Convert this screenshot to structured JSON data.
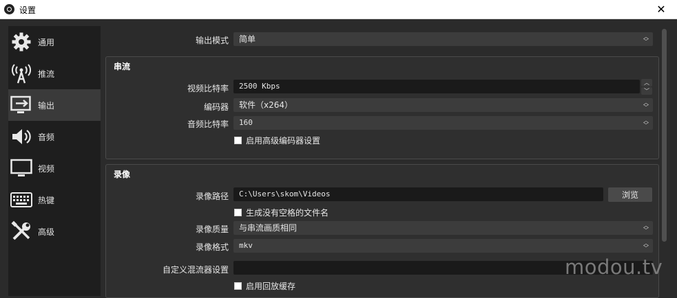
{
  "window": {
    "title": "设置",
    "close_glyph": "✕"
  },
  "sidebar": {
    "items": [
      {
        "label": "通用",
        "icon": "gear-icon"
      },
      {
        "label": "推流",
        "icon": "broadcast-icon"
      },
      {
        "label": "输出",
        "icon": "output-monitor-icon",
        "active": true
      },
      {
        "label": "音频",
        "icon": "speaker-icon"
      },
      {
        "label": "视频",
        "icon": "monitor-icon"
      },
      {
        "label": "热键",
        "icon": "keyboard-icon"
      },
      {
        "label": "高级",
        "icon": "tools-icon"
      }
    ]
  },
  "output_mode": {
    "label": "输出模式",
    "value": "简单"
  },
  "streaming": {
    "title": "串流",
    "video_bitrate_label": "视频比特率",
    "video_bitrate_value": "2500 Kbps",
    "encoder_label": "编码器",
    "encoder_value": "软件（x264）",
    "audio_bitrate_label": "音频比特率",
    "audio_bitrate_value": "160",
    "advanced_checkbox_label": "启用高级编码器设置"
  },
  "recording": {
    "title": "录像",
    "path_label": "录像路径",
    "path_value": "C:\\Users\\skom\\Videos",
    "browse_label": "浏览",
    "no_space_checkbox_label": "生成没有空格的文件名",
    "quality_label": "录像质量",
    "quality_value": "与串流画质相同",
    "format_label": "录像格式",
    "format_value": "mkv",
    "muxer_label": "自定义混流器设置",
    "muxer_value": "",
    "replay_checkbox_label": "启用回放缓存"
  },
  "watermark": "modou.tv",
  "colors": {
    "background": "#2b2b2b",
    "sidebar": "#1e1e1e",
    "sidebar_active": "#3a3a3a",
    "field": "#3c3c3c"
  }
}
